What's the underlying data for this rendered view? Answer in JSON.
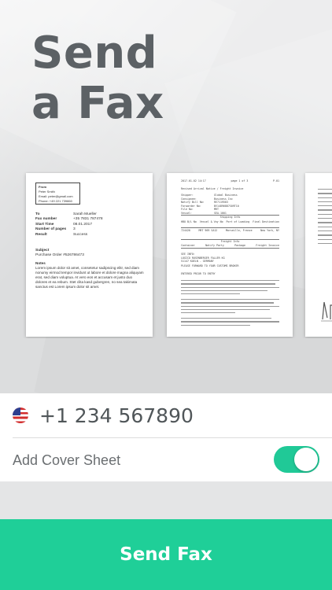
{
  "headline": {
    "line1": "Send",
    "line2": "a Fax"
  },
  "cover_page": {
    "from_title": "From",
    "from_name": "Peter Smith",
    "from_email": "Email: peter@gmail.com",
    "from_phone": "Phone: +49 221 739860",
    "rows": [
      {
        "key": "To",
        "value": "Sarah Mueller"
      },
      {
        "key": "Fax number",
        "value": "+35 7831 787478"
      },
      {
        "key": "Start Time",
        "value": "08.01.2017"
      },
      {
        "key": "Number of pages",
        "value": "3"
      },
      {
        "key": "Result",
        "value": "Success"
      }
    ],
    "subject_title": "Subject",
    "subject_value": "Purchase Order #526786473",
    "notes_title": "Notes",
    "notes_text": "Lorem ipsum dolor sit amet, consetetur sadipscing elitr, sed diam nonumy eirmod tempor invidunt ut labore et dolore magna aliquyam erat, sed diam voluptua. At vero eos et accusam et justo duo dolores et ea rebum. Stet clita kasd gubergren, no sea takimata sanctus est Lorem ipsum dolor sit amet."
  },
  "doc_page": {
    "header_left": "2017-01-02 14:17",
    "header_mid": "page 1 of 3",
    "header_right": "P.01",
    "title": "Revised Arrival Notice / Freight Invoice",
    "shipper_lines": [
      "Shipper:",
      "Consignee:",
      "Notify Bill No:",
      "Forwarder No:",
      "File No:",
      "Vessel:"
    ],
    "shipper_values": [
      "Global Business",
      "Business Inc",
      "RE7119503",
      "BV14896887S09T10",
      "MRT",
      "SEA-1001"
    ],
    "shipping_info": "Shipping Info",
    "cols1": [
      "HBO B/L No",
      "Vessel & Voy No",
      "Port of Loading",
      "Final Destination"
    ],
    "vals1": [
      "724420",
      "MRT 909 SA12",
      "Marseille, France",
      "New York, NY"
    ],
    "freight_info": "Freight Info",
    "cols2": [
      "Container",
      "Notify Party",
      "Package",
      "Freight Invoice"
    ],
    "addr_lines": [
      "SEE INFO:",
      "LOGICO ROSENBERGER FALLER KG",
      "51147 KOELN - GERMANY"
    ],
    "notice": "PLEASE FORWARD TO YOUR CUSTOMS BROKER",
    "sub_notice": "ENTERED PRIOR TO ENTRY"
  },
  "phone_number": "+1 234 567890",
  "cover_label": "Add Cover Sheet",
  "cover_enabled": true,
  "send_label": "Send Fax",
  "colors": {
    "accent": "#1fcf98",
    "headline": "#5c6165"
  }
}
